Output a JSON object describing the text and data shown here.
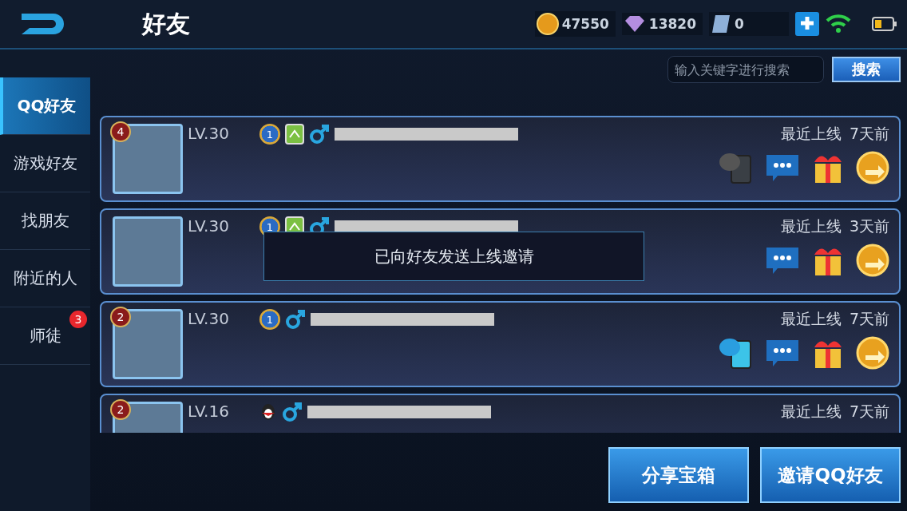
{
  "header": {
    "title": "好友",
    "gold": "47550",
    "diamonds": "13820",
    "coupons": "0"
  },
  "search": {
    "placeholder": "输入关键字进行搜索",
    "button": "搜索"
  },
  "sidebar": {
    "items": [
      {
        "label": "QQ好友",
        "selected": true
      },
      {
        "label": "游戏好友",
        "selected": false
      },
      {
        "label": "找朋友",
        "selected": false
      },
      {
        "label": "附近的人",
        "selected": false
      },
      {
        "label": "师徒",
        "selected": false,
        "badge": "3"
      }
    ]
  },
  "friends": [
    {
      "rank_badge": "4",
      "level": "LV.30",
      "icons": [
        {
          "kind": "rank",
          "text": "1"
        },
        {
          "kind": "device"
        },
        {
          "kind": "male"
        }
      ],
      "last_online_label": "最近上线",
      "last_online": "7天前",
      "hi": {
        "enabled": false
      },
      "show_actions": true
    },
    {
      "level": "LV.30",
      "icons": [
        {
          "kind": "rank",
          "text": "1"
        },
        {
          "kind": "device"
        },
        {
          "kind": "male"
        }
      ],
      "last_online_label": "最近上线",
      "last_online": "3天前",
      "show_actions": true
    },
    {
      "rank_badge": "2",
      "level": "LV.30",
      "icons": [
        {
          "kind": "rank",
          "text": "1"
        },
        {
          "kind": "male"
        }
      ],
      "last_online_label": "最近上线",
      "last_online": "7天前",
      "hi": {
        "enabled": true
      },
      "show_actions": true
    },
    {
      "rank_badge": "2",
      "level": "LV.16",
      "icons": [
        {
          "kind": "penguin"
        },
        {
          "kind": "male"
        }
      ],
      "last_online_label": "最近上线",
      "last_online": "7天前"
    }
  ],
  "toast": "已向好友发送上线邀请",
  "buttons": [
    "分享宝箱",
    "邀请QQ好友"
  ]
}
